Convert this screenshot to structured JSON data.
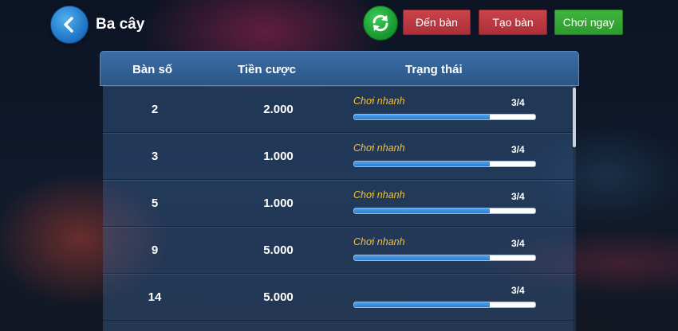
{
  "header": {
    "title": "Ba cây",
    "buttons": {
      "join": "Đến bàn",
      "create": "Tạo bàn",
      "play": "Chơi ngay"
    }
  },
  "table": {
    "columns": [
      "Bàn số",
      "Tiền cược",
      "Trạng thái"
    ],
    "rows": [
      {
        "number": "2",
        "bet": "2.000",
        "status": "Chơi nhanh",
        "players": "3/4",
        "fill": 0.75
      },
      {
        "number": "3",
        "bet": "1.000",
        "status": "Chơi nhanh",
        "players": "3/4",
        "fill": 0.75
      },
      {
        "number": "5",
        "bet": "1.000",
        "status": "Chơi nhanh",
        "players": "3/4",
        "fill": 0.75
      },
      {
        "number": "9",
        "bet": "5.000",
        "status": "Chơi nhanh",
        "players": "3/4",
        "fill": 0.75
      },
      {
        "number": "14",
        "bet": "5.000",
        "status": "",
        "players": "3/4",
        "fill": 0.75
      }
    ]
  },
  "colors": {
    "accent_blue": "#2b7fd6",
    "button_red": "#b8373f",
    "button_green": "#35a835",
    "status_text": "#f0c040"
  },
  "icons": {
    "back": "chevron-left-icon",
    "refresh": "refresh-icon"
  }
}
